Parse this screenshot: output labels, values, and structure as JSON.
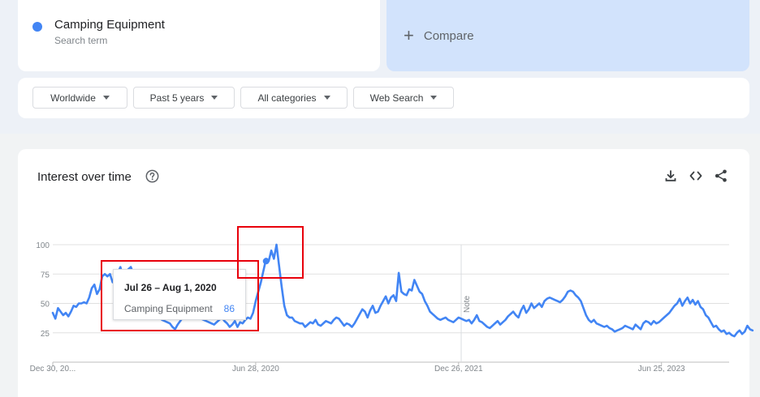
{
  "search_term": {
    "name": "Camping Equipment",
    "subtitle": "Search term",
    "color": "#4285f4"
  },
  "compare": {
    "plus": "+",
    "label": "Compare"
  },
  "filters": [
    {
      "label": "Worldwide"
    },
    {
      "label": "Past 5 years"
    },
    {
      "label": "All categories"
    },
    {
      "label": "Web Search"
    }
  ],
  "chart": {
    "title": "Interest over time",
    "icons": [
      "help-icon",
      "download-icon",
      "embed-icon",
      "share-icon"
    ],
    "note_label": "Note",
    "line_color": "#4285f4",
    "highlight_color": "#e8000b"
  },
  "tooltip": {
    "date": "Jul 26 – Aug 1, 2020",
    "term": "Camping Equipment",
    "value": "86"
  },
  "chart_data": {
    "type": "line",
    "title": "Interest over time",
    "xlabel": "",
    "ylabel": "",
    "ylim": [
      0,
      100
    ],
    "yticks": [
      25,
      50,
      75,
      100
    ],
    "xlim": [
      "2018-12-30",
      "2023-12-24"
    ],
    "xticks": [
      {
        "date": "2018-12-30",
        "label": "Dec 30, 20..."
      },
      {
        "date": "2020-06-28",
        "label": "Jun 28, 2020"
      },
      {
        "date": "2021-12-26",
        "label": "Dec 26, 2021"
      },
      {
        "date": "2023-06-25",
        "label": "Jun 25, 2023"
      }
    ],
    "grid": true,
    "note_date": "2022-01-02",
    "series": [
      {
        "name": "Camping Equipment",
        "start": "2018-12-30",
        "interval_days": 7,
        "values": [
          42,
          37,
          46,
          43,
          40,
          42,
          39,
          43,
          48,
          47,
          50,
          50,
          51,
          50,
          55,
          63,
          66,
          58,
          62,
          73,
          75,
          73,
          75,
          68,
          72,
          76,
          81,
          72,
          74,
          79,
          81,
          75,
          70,
          65,
          58,
          52,
          48,
          45,
          44,
          42,
          40,
          38,
          36,
          35,
          34,
          33,
          30,
          28,
          32,
          35,
          38,
          40,
          42,
          41,
          40,
          39,
          38,
          37,
          36,
          35,
          34,
          33,
          32,
          34,
          36,
          38,
          35,
          33,
          30,
          32,
          35,
          30,
          34,
          33,
          36,
          38,
          37,
          42,
          52,
          60,
          68,
          78,
          88,
          86,
          95,
          88,
          100,
          82,
          64,
          48,
          40,
          38,
          38,
          35,
          34,
          33,
          33,
          30,
          32,
          34,
          33,
          36,
          32,
          31,
          33,
          35,
          34,
          33,
          36,
          38,
          37,
          34,
          31,
          33,
          32,
          30,
          33,
          37,
          41,
          45,
          43,
          38,
          44,
          48,
          42,
          43,
          48,
          52,
          56,
          50,
          55,
          57,
          52,
          76,
          60,
          58,
          57,
          62,
          61,
          70,
          65,
          60,
          58,
          52,
          48,
          43,
          41,
          39,
          37,
          36,
          37,
          38,
          36,
          35,
          34,
          36,
          38,
          37,
          36,
          35,
          36,
          33,
          36,
          40,
          35,
          34,
          32,
          30,
          29,
          31,
          33,
          35,
          32,
          34,
          36,
          39,
          41,
          43,
          40,
          38,
          44,
          48,
          42,
          45,
          50,
          46,
          48,
          50,
          47,
          52,
          54,
          55,
          54,
          53,
          52,
          51,
          53,
          56,
          60,
          61,
          60,
          57,
          55,
          52,
          46,
          40,
          36,
          34,
          36,
          33,
          32,
          31,
          30,
          31,
          29,
          28,
          26,
          27,
          28,
          29,
          31,
          30,
          29,
          28,
          32,
          30,
          28,
          33,
          35,
          34,
          32,
          35,
          33,
          34,
          36,
          38,
          40,
          42,
          45,
          48,
          50,
          54,
          48,
          52,
          55,
          50,
          53,
          49,
          52,
          47,
          45,
          40,
          38,
          34,
          30,
          31,
          28,
          26,
          27,
          24,
          25,
          23,
          22,
          25,
          27,
          24,
          26,
          31,
          28,
          27
        ]
      }
    ]
  }
}
